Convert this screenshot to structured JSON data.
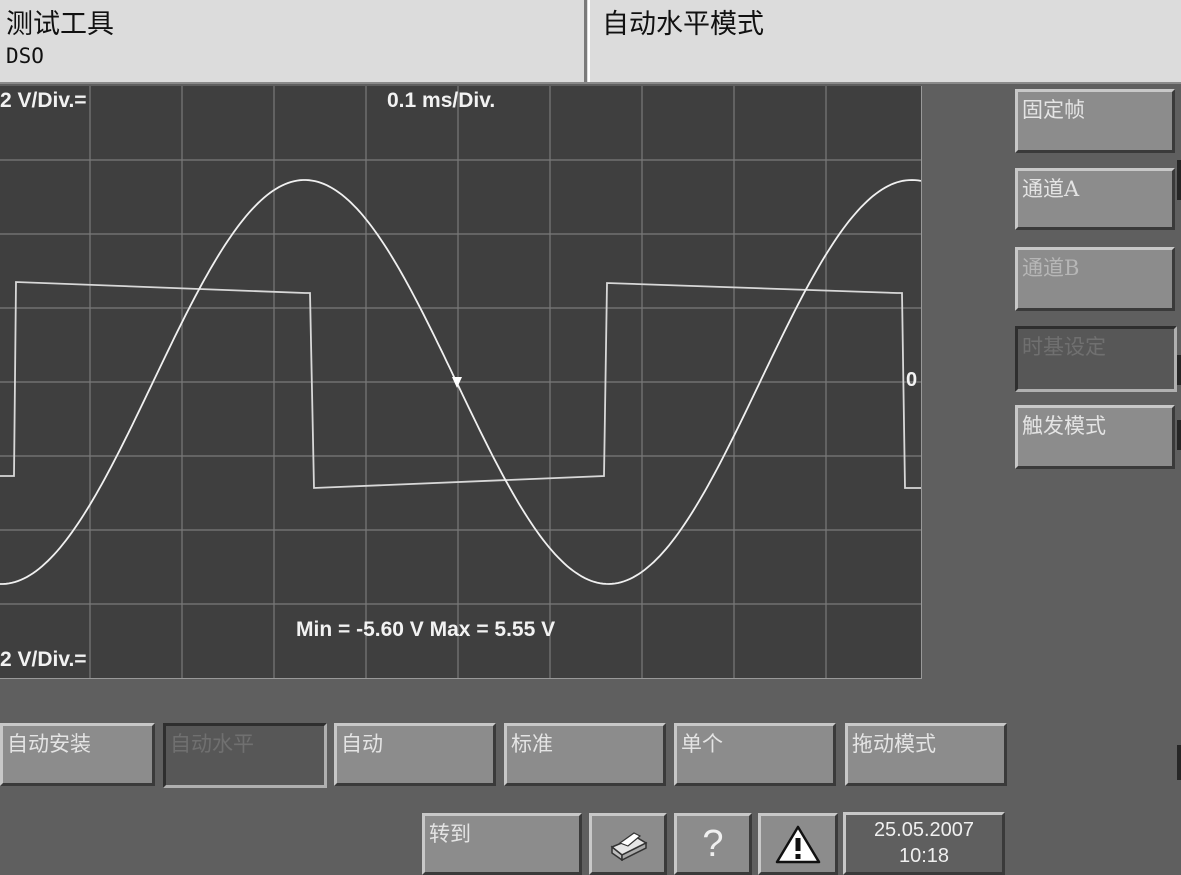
{
  "header": {
    "tool_title": "测试工具",
    "tool_sub": "DSO",
    "mode_title": "自动水平模式"
  },
  "scope": {
    "v_div_top": "2 V/Div.=",
    "t_div": "0.1 ms/Div.",
    "v_div_bottom": "2 V/Div.=",
    "zero_marker": "0",
    "measure": "Min = -5.60 V   Max = 5.55 V"
  },
  "side_buttons": [
    {
      "label": "固定帧"
    },
    {
      "label": "通道A"
    },
    {
      "label": "通道B"
    },
    {
      "label": "时基设定"
    },
    {
      "label": "触发模式"
    }
  ],
  "bottom_buttons": [
    {
      "label": "自动安装"
    },
    {
      "label": "自动水平"
    },
    {
      "label": "自动"
    },
    {
      "label": "标准"
    },
    {
      "label": "单个"
    },
    {
      "label": "拖动模式"
    }
  ],
  "toolbar": {
    "goto_label": "转到",
    "help_label": "?",
    "date": "25.05.2007",
    "time": "10:18"
  },
  "icons": {
    "print": "printer-icon",
    "warning": "warning-icon"
  }
}
